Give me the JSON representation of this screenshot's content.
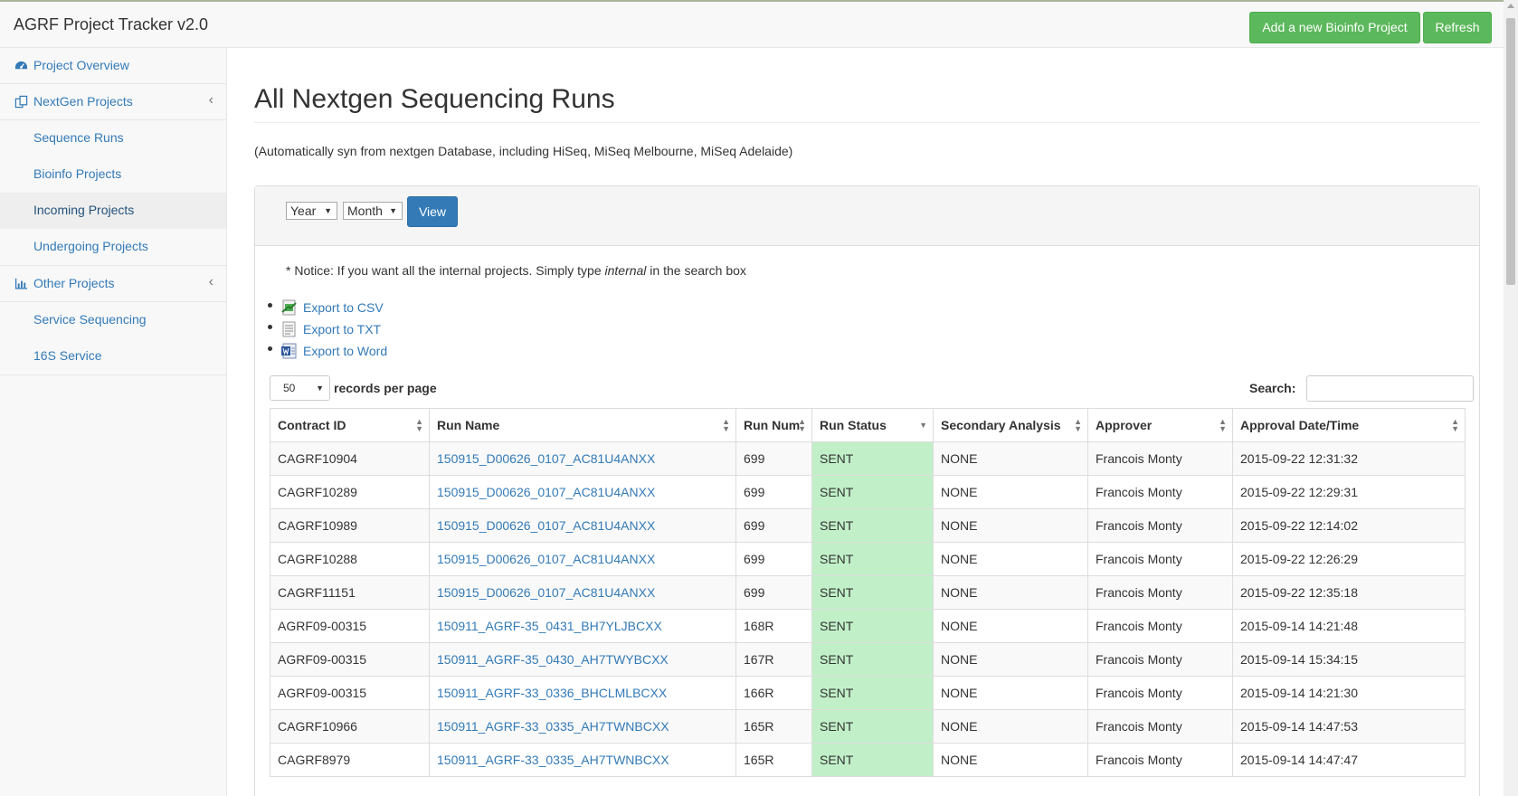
{
  "header": {
    "brand": "AGRF Project Tracker v2.0",
    "add_button": "Add a new Bioinfo Project",
    "refresh_button": "Refresh"
  },
  "sidebar": {
    "project_overview": "Project Overview",
    "nextgen_projects": "NextGen Projects",
    "sequence_runs": "Sequence Runs",
    "bioinfo_projects": "Bioinfo Projects",
    "incoming_projects": "Incoming Projects",
    "undergoing_projects": "Undergoing Projects",
    "other_projects": "Other Projects",
    "service_sequencing": "Service Sequencing",
    "sixteen_s_service": "16S Service",
    "chevron": "‹"
  },
  "main": {
    "title": "All Nextgen Sequencing Runs",
    "subtitle": "(Automatically syn from nextgen Database, including HiSeq, MiSeq Melbourne, MiSeq Adelaide)",
    "filter": {
      "year": "Year",
      "month": "Month",
      "view_button": "View"
    },
    "notice_prefix": "* Notice: If you want all the internal projects. Simply type ",
    "notice_em": "internal",
    "notice_suffix": " in the search box",
    "exports": {
      "csv": "Export to CSV",
      "txt": "Export to TXT",
      "word": "Export to Word"
    },
    "page_length": "50",
    "records_per_page": "records per page",
    "search_label": "Search:",
    "status_color": "#c1f0c8"
  },
  "table": {
    "columns": [
      "Contract ID",
      "Run Name",
      "Run Num",
      "Run Status",
      "Secondary Analysis",
      "Approver",
      "Approval Date/Time"
    ],
    "rows": [
      [
        "CAGRF10904",
        "150915_D00626_0107_AC81U4ANXX",
        "699",
        "SENT",
        "NONE",
        "Francois Monty",
        "2015-09-22 12:31:32"
      ],
      [
        "CAGRF10289",
        "150915_D00626_0107_AC81U4ANXX",
        "699",
        "SENT",
        "NONE",
        "Francois Monty",
        "2015-09-22 12:29:31"
      ],
      [
        "CAGRF10989",
        "150915_D00626_0107_AC81U4ANXX",
        "699",
        "SENT",
        "NONE",
        "Francois Monty",
        "2015-09-22 12:14:02"
      ],
      [
        "CAGRF10288",
        "150915_D00626_0107_AC81U4ANXX",
        "699",
        "SENT",
        "NONE",
        "Francois Monty",
        "2015-09-22 12:26:29"
      ],
      [
        "CAGRF11151",
        "150915_D00626_0107_AC81U4ANXX",
        "699",
        "SENT",
        "NONE",
        "Francois Monty",
        "2015-09-22 12:35:18"
      ],
      [
        "AGRF09-00315",
        "150911_AGRF-35_0431_BH7YLJBCXX",
        "168R",
        "SENT",
        "NONE",
        "Francois Monty",
        "2015-09-14 14:21:48"
      ],
      [
        "AGRF09-00315",
        "150911_AGRF-35_0430_AH7TWYBCXX",
        "167R",
        "SENT",
        "NONE",
        "Francois Monty",
        "2015-09-14 15:34:15"
      ],
      [
        "AGRF09-00315",
        "150911_AGRF-33_0336_BHCLMLBCXX",
        "166R",
        "SENT",
        "NONE",
        "Francois Monty",
        "2015-09-14 14:21:30"
      ],
      [
        "CAGRF10966",
        "150911_AGRF-33_0335_AH7TWNBCXX",
        "165R",
        "SENT",
        "NONE",
        "Francois Monty",
        "2015-09-14 14:47:53"
      ],
      [
        "CAGRF8979",
        "150911_AGRF-33_0335_AH7TWNBCXX",
        "165R",
        "SENT",
        "NONE",
        "Francois Monty",
        "2015-09-14 14:47:47"
      ]
    ]
  }
}
